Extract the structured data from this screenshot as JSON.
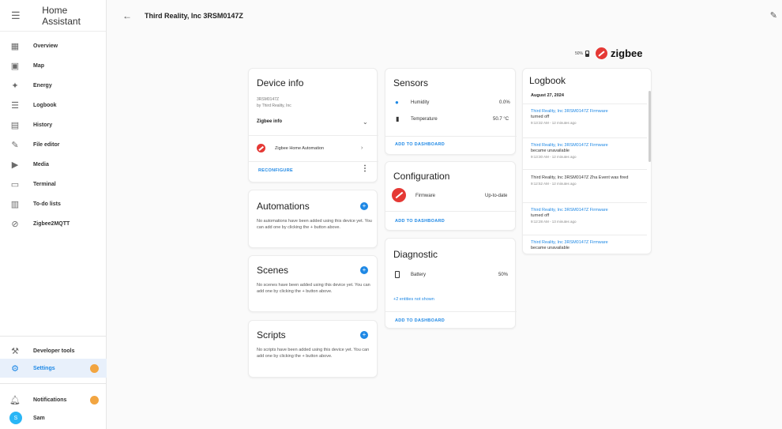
{
  "app": {
    "title": "Home Assistant"
  },
  "header": {
    "title": "Third Reality, Inc 3RSM0147Z"
  },
  "sidebar": {
    "items": [
      {
        "label": "Overview",
        "icon": "grid-icon"
      },
      {
        "label": "Map",
        "icon": "map-icon"
      },
      {
        "label": "Energy",
        "icon": "energy-icon"
      },
      {
        "label": "Logbook",
        "icon": "list-icon"
      },
      {
        "label": "History",
        "icon": "chart-icon"
      },
      {
        "label": "File editor",
        "icon": "wrench-icon"
      },
      {
        "label": "Media",
        "icon": "media-icon"
      },
      {
        "label": "Terminal",
        "icon": "terminal-icon"
      },
      {
        "label": "To-do lists",
        "icon": "clipboard-icon"
      },
      {
        "label": "Zigbee2MQTT",
        "icon": "zigbee-icon"
      }
    ],
    "developer_tools": "Developer tools",
    "settings": "Settings",
    "notifications": "Notifications",
    "user": {
      "name": "Sam",
      "initial": "S"
    }
  },
  "brand": {
    "battery": "50%",
    "logo_text": "zigbee",
    "accent": "#e53935"
  },
  "device_info": {
    "title": "Device info",
    "model": "3RSM0147Z",
    "manufacturer": "by Third Reality, Inc",
    "zigbee_info": "Zigbee info",
    "integration": "Zigbee Home Automation",
    "reconfigure": "RECONFIGURE"
  },
  "automations": {
    "title": "Automations",
    "text": "No automations have been added using this device yet. You can add one by clicking the + button above."
  },
  "scenes": {
    "title": "Scenes",
    "text": "No scenes have been added using this device yet. You can add one by clicking the + button above."
  },
  "scripts": {
    "title": "Scripts",
    "text": "No scripts have been added using this device yet. You can add one by clicking the + button above."
  },
  "sensors": {
    "title": "Sensors",
    "rows": [
      {
        "name": "Humidity",
        "value": "0.0%"
      },
      {
        "name": "Temperature",
        "value": "50.7 °C"
      }
    ],
    "add": "ADD TO DASHBOARD"
  },
  "configuration": {
    "title": "Configuration",
    "name": "Firmware",
    "value": "Up-to-date",
    "add": "ADD TO DASHBOARD"
  },
  "diagnostic": {
    "title": "Diagnostic",
    "name": "Battery",
    "value": "50%",
    "hidden": "+2 entities not shown",
    "add": "ADD TO DASHBOARD"
  },
  "logbook": {
    "title": "Logbook",
    "date": "August 27, 2024",
    "entries": [
      {
        "name": "Third Reality, Inc 3RSM0147Z Firmware",
        "action": "turned off",
        "time": "9:13:32 AM - 12 minutes ago"
      },
      {
        "name": "Third Reality, Inc 3RSM0147Z Firmware",
        "action": "became unavailable",
        "time": "9:13:30 AM - 12 minutes ago"
      },
      {
        "name": "",
        "action": "Third Reality, Inc 3RSM0147Z Zha Event was fired",
        "time": "9:12:52 AM - 12 minutes ago"
      },
      {
        "name": "Third Reality, Inc 3RSM0147Z Firmware",
        "action": "turned off",
        "time": "9:12:28 AM - 13 minutes ago"
      },
      {
        "name": "Third Reality, Inc 3RSM0147Z Firmware",
        "action": "became unavailable",
        "time": ""
      }
    ]
  }
}
